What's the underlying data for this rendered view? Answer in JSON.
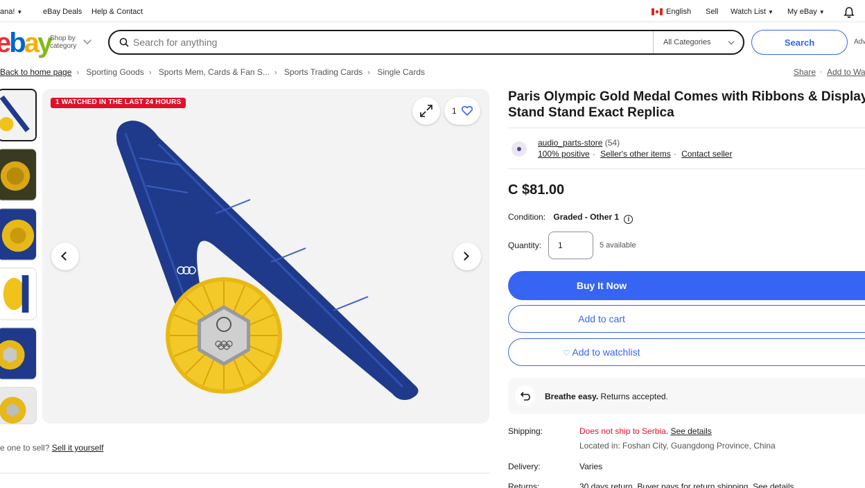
{
  "topbar": {
    "greeting": "ana!",
    "deals": "eBay Deals",
    "help": "Help & Contact",
    "language": "English",
    "sell": "Sell",
    "watchlist": "Watch List",
    "my_ebay": "My eBay"
  },
  "header": {
    "logo": [
      "e",
      "b",
      "a",
      "y"
    ],
    "shop_by_line1": "Shop by",
    "shop_by_line2": "category",
    "search_placeholder": "Search for anything",
    "category_selected": "All Categories",
    "search_button": "Search",
    "advanced": "Adv"
  },
  "breadcrumb": {
    "items": [
      "Back to home page",
      "Sporting Goods",
      "Sports Mem, Cards & Fan S...",
      "Sports Trading Cards",
      "Single Cards"
    ],
    "share": "Share",
    "add_to_watchlist": "Add to Wa"
  },
  "gallery": {
    "badge": "1 WATCHED IN THE LAST 24 HOURS",
    "watch_count": "1",
    "sell_prompt": "e one to sell?",
    "sell_link": "Sell it yourself"
  },
  "listing": {
    "title": "Paris Olympic Gold Medal Comes with Ribbons & Display Stand Stand Exact Replica",
    "seller": {
      "name": "audio_parts-store",
      "feedback": "(54)",
      "positive": "100% positive",
      "other_items": "Seller's other items",
      "contact": "Contact seller"
    },
    "price": "C $81.00",
    "condition_label": "Condition:",
    "condition_value": "Graded - Other 1",
    "quantity_label": "Quantity:",
    "quantity_value": "1",
    "available": "5 available",
    "buy_now": "Buy It Now",
    "add_to_cart": "Add to cart",
    "add_to_watchlist": "Add to watchlist",
    "returns_bold": "Breathe easy.",
    "returns_text": "Returns accepted.",
    "shipping_label": "Shipping:",
    "shipping_status": "Does not ship to Serbia",
    "shipping_dot": ".",
    "see_details": "See details",
    "located_in": "Located in: Foshan City, Guangdong Province, China",
    "delivery_label": "Delivery:",
    "delivery_value": "Varies",
    "returns_label": "Returns:",
    "returns_value": "30 days return. Buyer pays for return shipping. See details"
  },
  "colors": {
    "primary_blue": "#3665f3",
    "alert_red": "#e0102a",
    "ribbon_blue": "#1f3a8a",
    "medal_gold": "#f0c21a"
  }
}
